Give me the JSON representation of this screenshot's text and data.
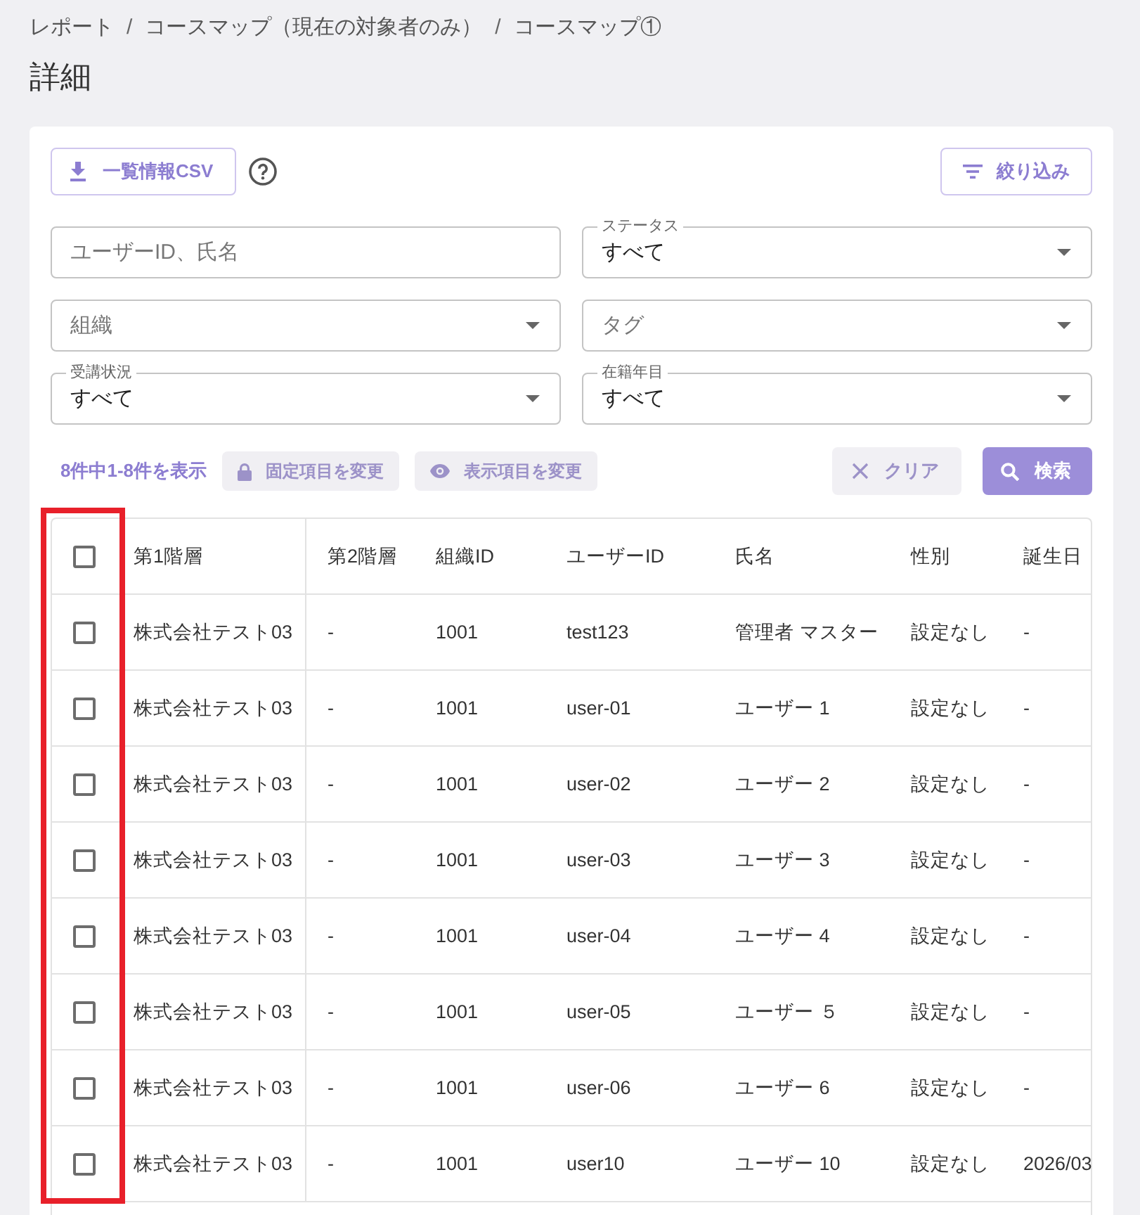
{
  "breadcrumb": [
    {
      "label": "レポート",
      "separator": "/"
    },
    {
      "label": "コースマップ（現在の対象者のみ）",
      "separator": "/"
    },
    {
      "label": "コースマップ①"
    }
  ],
  "page_title": "詳細",
  "toolbar": {
    "csv_button": {
      "label": "一覧情報CSV"
    },
    "filter_button": {
      "label": "絞り込み"
    }
  },
  "filter_rows": [
    {
      "fields": [
        {
          "kind": "text",
          "placeholder": "ユーザーID、氏名"
        },
        {
          "kind": "select",
          "label": "ステータス",
          "value": "すべて"
        }
      ]
    },
    {
      "fields": [
        {
          "kind": "select",
          "placeholder": "組織"
        },
        {
          "kind": "select",
          "placeholder": "タグ"
        }
      ]
    },
    {
      "fields": [
        {
          "kind": "select",
          "label": "受講状況",
          "value": "すべて"
        },
        {
          "kind": "select",
          "label": "在籍年目",
          "value": "すべて"
        }
      ]
    }
  ],
  "result_bar": {
    "count": "8件中1-8件を表示",
    "buttons": [
      {
        "kind": "lock",
        "label": "固定項目を変更"
      },
      {
        "kind": "eye",
        "label": "表示項目を変更"
      },
      {
        "kind": "clear",
        "label": "クリア"
      },
      {
        "kind": "search",
        "label": "検索"
      }
    ]
  },
  "table": {
    "select_all": {
      "checked": false
    },
    "select_column_highlighted": true,
    "columns": [
      "第1階層",
      "第2階層",
      "組織ID",
      "ユーザーID",
      "氏名",
      "性別",
      "誕生日"
    ],
    "rows": [
      {
        "checked": false,
        "cells": [
          "株式会社テスト03",
          "-",
          "1001",
          "test123",
          "管理者 マスター",
          "設定なし",
          "-"
        ]
      },
      {
        "checked": false,
        "cells": [
          "株式会社テスト03",
          "-",
          "1001",
          "user-01",
          "ユーザー 1",
          "設定なし",
          "-"
        ]
      },
      {
        "checked": false,
        "cells": [
          "株式会社テスト03",
          "-",
          "1001",
          "user-02",
          "ユーザー 2",
          "設定なし",
          "-"
        ]
      },
      {
        "checked": false,
        "cells": [
          "株式会社テスト03",
          "-",
          "1001",
          "user-03",
          "ユーザー 3",
          "設定なし",
          "-"
        ]
      },
      {
        "checked": false,
        "cells": [
          "株式会社テスト03",
          "-",
          "1001",
          "user-04",
          "ユーザー 4",
          "設定なし",
          "-"
        ]
      },
      {
        "checked": false,
        "cells": [
          "株式会社テスト03",
          "-",
          "1001",
          "user-05",
          "ユーザー ５",
          "設定なし",
          "-"
        ]
      },
      {
        "checked": false,
        "cells": [
          "株式会社テスト03",
          "-",
          "1001",
          "user-06",
          "ユーザー 6",
          "設定なし",
          "-"
        ]
      },
      {
        "checked": false,
        "cells": [
          "株式会社テスト03",
          "-",
          "1001",
          "user10",
          "ユーザー 10",
          "設定なし",
          "2026/03"
        ]
      }
    ]
  }
}
